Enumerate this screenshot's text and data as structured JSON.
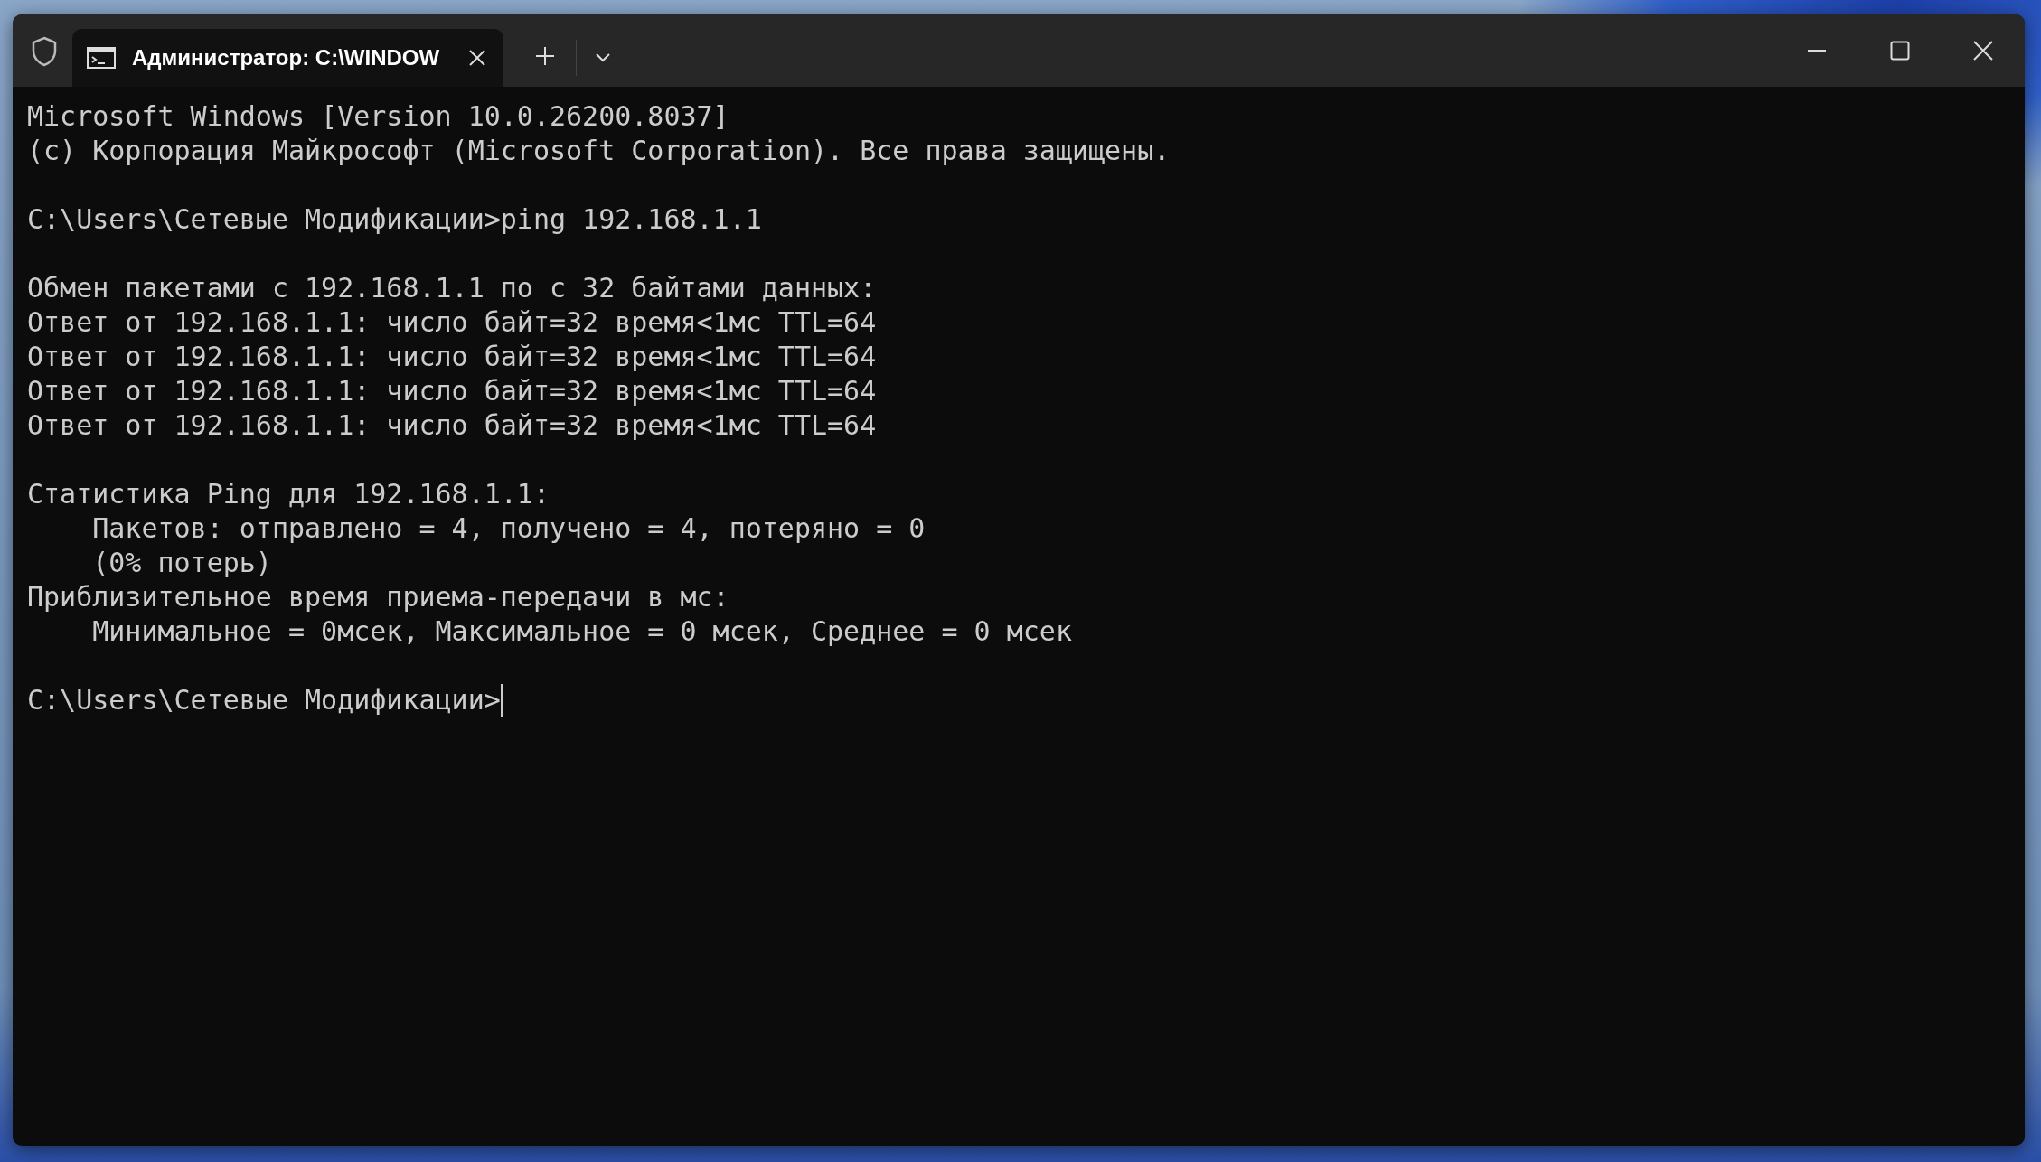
{
  "tabs": [
    {
      "title": "Администратор: C:\\WINDOW",
      "selected": true
    }
  ],
  "terminal": {
    "blocks": [
      [
        "Microsoft Windows [Version 10.0.26200.8037]",
        "(c) Корпорация Майкрософт (Microsoft Corporation). Все права защищены."
      ],
      [
        "C:\\Users\\Сетевые Модификации>ping 192.168.1.1"
      ],
      [
        "Обмен пакетами с 192.168.1.1 по с 32 байтами данных:",
        "Ответ от 192.168.1.1: число байт=32 время<1мс TTL=64",
        "Ответ от 192.168.1.1: число байт=32 время<1мс TTL=64",
        "Ответ от 192.168.1.1: число байт=32 время<1мс TTL=64",
        "Ответ от 192.168.1.1: число байт=32 время<1мс TTL=64"
      ],
      [
        "Статистика Ping для 192.168.1.1:",
        "    Пакетов: отправлено = 4, получено = 4, потеряно = 0",
        "    (0% потерь)",
        "Приблизительное время приема-передачи в мс:",
        "    Минимальное = 0мсек, Максимальное = 0 мсек, Среднее = 0 мсек"
      ]
    ],
    "prompt": {
      "text": "C:\\Users\\Сетевые Модификации>",
      "cursor": true
    }
  }
}
